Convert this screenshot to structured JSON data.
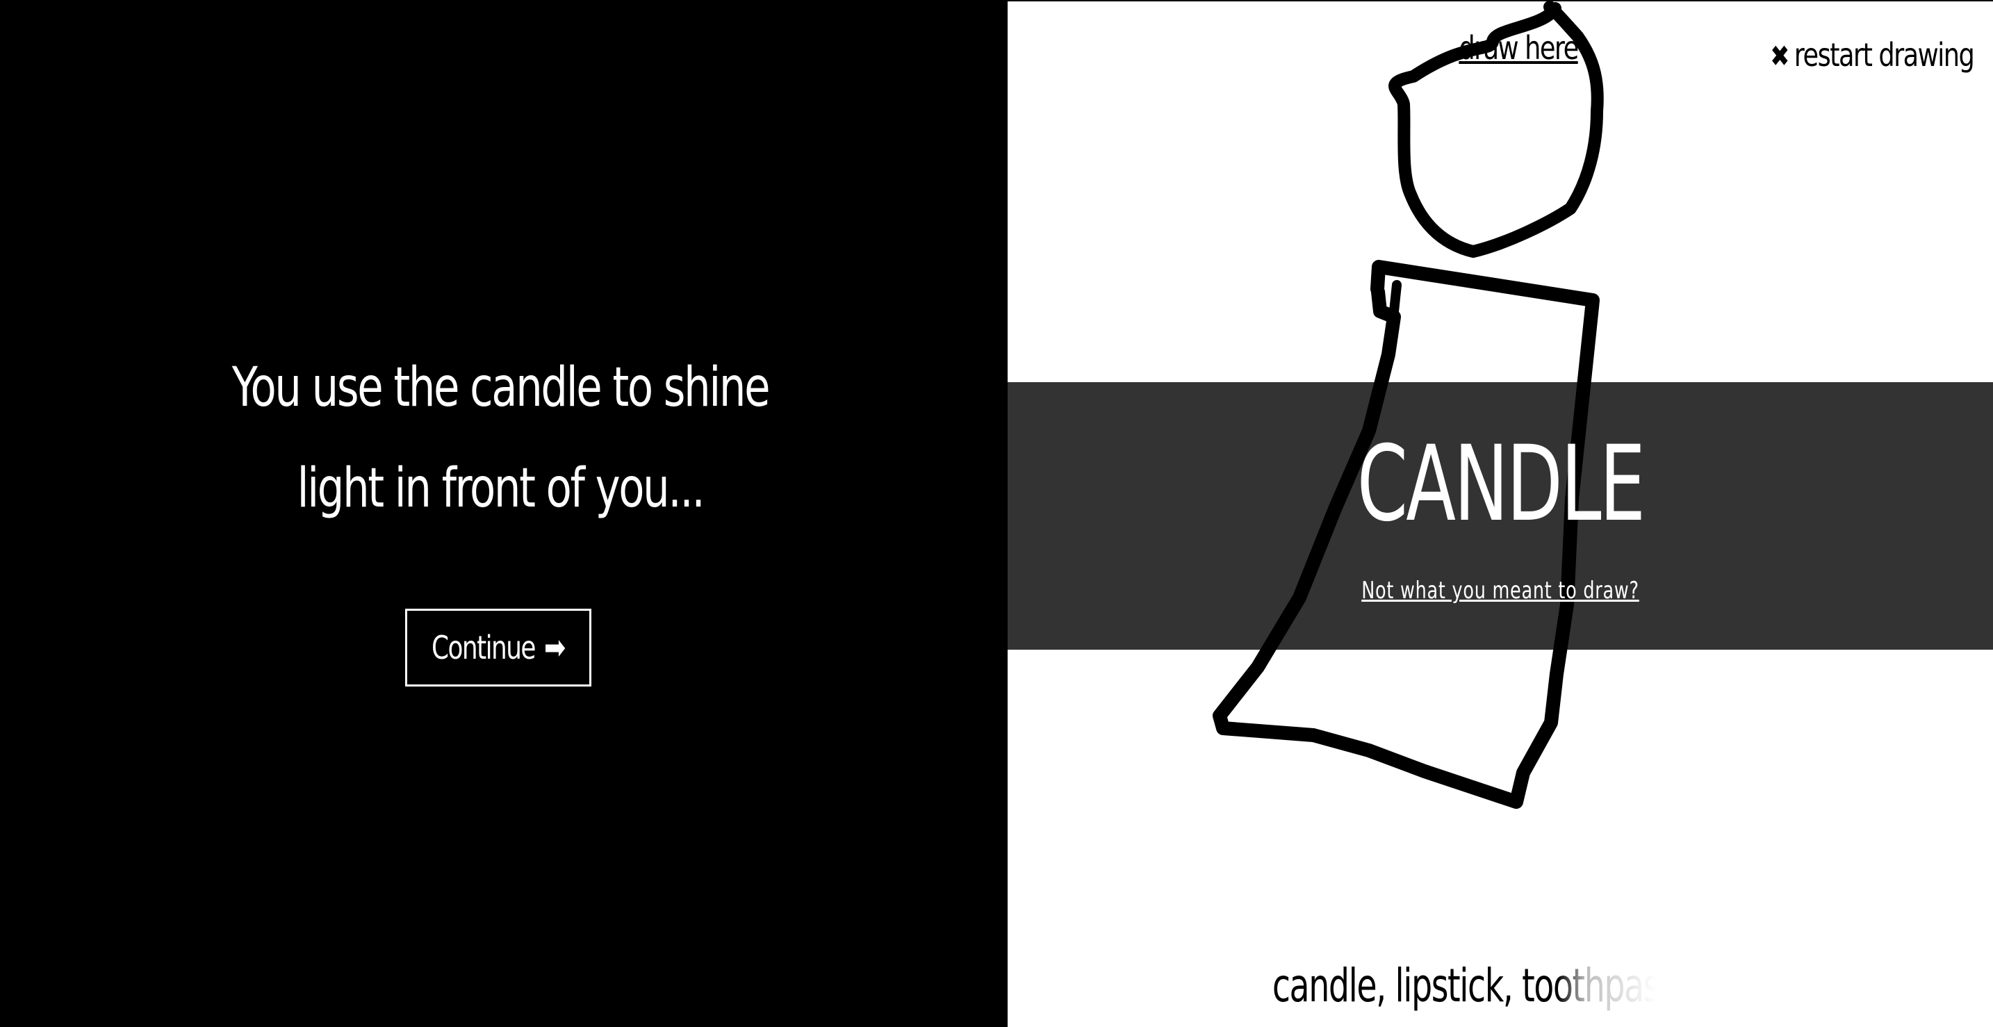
{
  "story": {
    "line1": "You use the candle to shine",
    "line2": "light in front of you..."
  },
  "continue_button": {
    "label": "Continue",
    "icon": "right-arrow-icon"
  },
  "canvas": {
    "draw_here_label": "draw here",
    "restart_label": "restart drawing",
    "restart_icon": "close-icon",
    "background": "#ffffff",
    "stroke_color": "#000000"
  },
  "guess": {
    "word": "CANDLE",
    "not_meant_label": "Not what you meant to draw?",
    "band_color": "#333333"
  },
  "suggestions": {
    "text": "candle, lipstick, toothpaste, v"
  }
}
